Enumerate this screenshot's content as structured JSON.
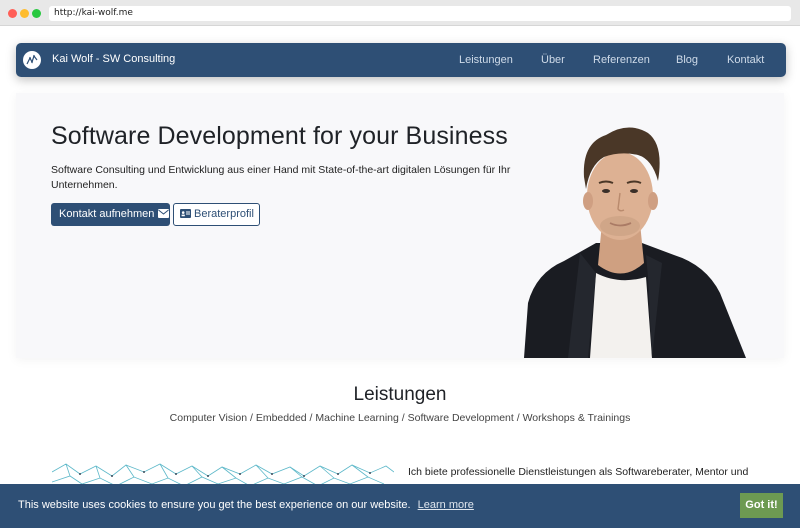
{
  "browser": {
    "url": "http://kai-wolf.me"
  },
  "nav": {
    "brand": "Kai Wolf - SW Consulting",
    "links": [
      "Leistungen",
      "Über",
      "Referenzen",
      "Blog",
      "Kontakt"
    ]
  },
  "hero": {
    "title": "Software Development for your Business",
    "subtitle": "Software Consulting und Entwicklung aus einer Hand mit State-of-the-art digitalen Lösungen für Ihr Unternehmen.",
    "primary_button": "Kontakt aufnehmen",
    "secondary_button": "Beraterprofil"
  },
  "services": {
    "title": "Leistungen",
    "subtitle": "Computer Vision / Embedded / Machine Learning / Software Development / Workshops & Trainings",
    "intro": "Ich biete professionelle Dienstleistungen als Softwareberater, Mentor und"
  },
  "cookie": {
    "message": "This website uses cookies to ensure you get the best experience on our website.",
    "link": "Learn more",
    "button": "Got it!"
  },
  "colors": {
    "brand_blue": "#2e4f75",
    "cookie_button": "#6d9a52",
    "hero_bg": "#f8f8fa"
  }
}
